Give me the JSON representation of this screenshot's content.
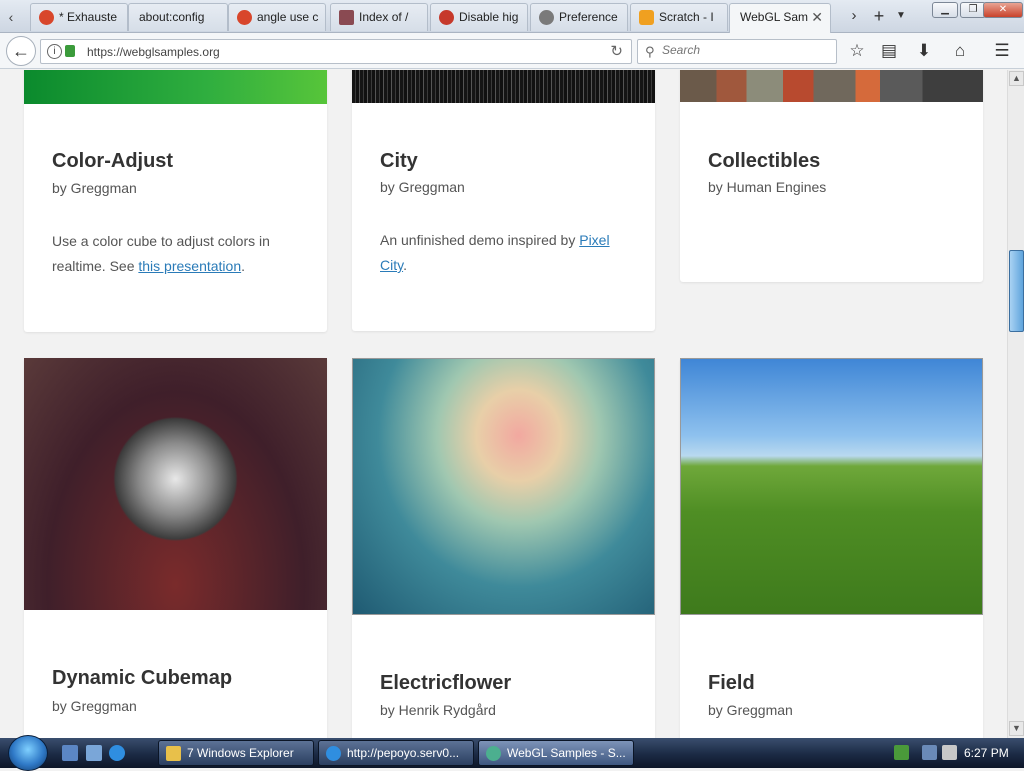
{
  "browser": {
    "tabs": [
      {
        "label": "* Exhauste",
        "favicon": "opera-icon",
        "color": "#d8462b"
      },
      {
        "label": "about:config",
        "favicon": "none",
        "color": "#ffffff"
      },
      {
        "label": "angle use c",
        "favicon": "opera-icon",
        "color": "#d8462b"
      },
      {
        "label": "Index of /",
        "favicon": "ff-devtools-icon",
        "color": "#8a4a52"
      },
      {
        "label": "Disable hig",
        "favicon": "mozilla-icon",
        "color": "#c6392b"
      },
      {
        "label": "Preference",
        "favicon": "gear-icon",
        "color": "#7a7a7a"
      },
      {
        "label": "Scratch - I",
        "favicon": "scratch-icon",
        "color": "#f0a020"
      },
      {
        "label": "WebGL Sam",
        "favicon": "none",
        "color": "#ffffff"
      }
    ],
    "url": "https://webglsamples.org",
    "search_placeholder": "Search"
  },
  "cards": [
    {
      "title": "Color-Adjust",
      "author": "by Greggman",
      "desc_prefix": "Use a color cube to adjust colors in realtime. See ",
      "link": "this presentation",
      "desc_suffix": "."
    },
    {
      "title": "City",
      "author": "by Greggman",
      "desc_prefix": "An unfinished demo inspired by ",
      "link": "Pixel City",
      "desc_suffix": "."
    },
    {
      "title": "Collectibles",
      "author": "by Human Engines"
    },
    {
      "title": "Dynamic Cubemap",
      "author": "by Greggman"
    },
    {
      "title": "Electricflower",
      "author": "by Henrik Rydgård"
    },
    {
      "title": "Field",
      "author": "by Greggman"
    }
  ],
  "taskbar": {
    "buttons": [
      {
        "label": "7 Windows Explorer"
      },
      {
        "label": "http://pepoyo.serv0..."
      },
      {
        "label": "WebGL Samples - S..."
      }
    ],
    "clock": "6:27 PM"
  },
  "colors": {
    "accent_link": "#2a7bb8",
    "scroll_thumb": "#5fa4dc"
  }
}
